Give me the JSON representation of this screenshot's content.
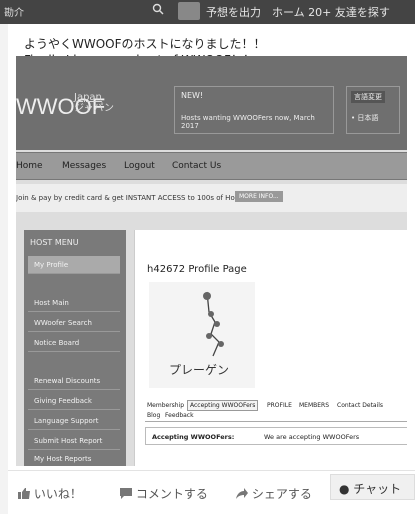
{
  "topbar": {
    "user": "勘介",
    "right_text": "予想を出力　ホーム  20+  友達を探す"
  },
  "post": {
    "line1": "ようやくWWOOFのホストになりました！！",
    "line2": "Finally I became a host of WWOOF！！"
  },
  "site": {
    "logo": "WWOOF",
    "logo_sub1": "Japan",
    "logo_sub2": "ジャパン",
    "new_box": {
      "title": "NEW!",
      "item": "Hosts wanting WWOOFers now, March 2017"
    },
    "lang_box": {
      "button": "言語変更",
      "item": "• 日本語"
    },
    "nav": [
      "Home",
      "Messages",
      "Logout",
      "Contact Us"
    ],
    "promo": {
      "text": "Join & pay by credit card  & get INSTANT ACCESS  to 100s of Hosts",
      "more": "MORE INFO..."
    },
    "sidebar": {
      "title": "HOST MENU",
      "items": [
        "My Profile",
        "Host Main",
        "WWoofer Search",
        "Notice Board",
        "Renewal Discounts",
        "Giving Feedback",
        "Language Support",
        "Submit Host Report",
        "My Host Reports"
      ]
    },
    "profile": {
      "title": "h42672 Profile Page",
      "image_caption": "プレーゲン",
      "tabs": [
        "Membership",
        "Accepting WWOOFers",
        "PROFILE",
        "MEMBERS",
        "Contact Details",
        "Blog",
        "Feedback"
      ],
      "accepting_label": "Accepting WWOOFers:",
      "accepting_value": "We are accepting WWOOFers"
    }
  },
  "actions": {
    "like": "いいね！",
    "comment": "コメントする",
    "share": "シェアする",
    "chat": "● チャット"
  }
}
